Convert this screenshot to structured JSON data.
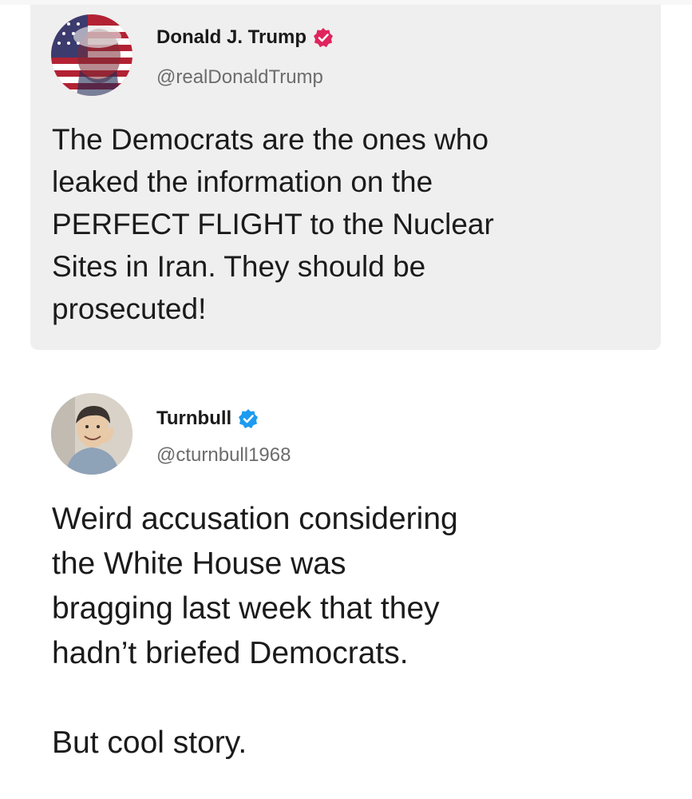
{
  "posts": [
    {
      "display_name": "Donald J. Trump",
      "handle": "@realDonaldTrump",
      "badge_color": "#e0245e",
      "body_lines": [
        "The Democrats are the ones who",
        "leaked the information on the",
        "PERFECT FLIGHT to the Nuclear",
        "Sites in Iran. They should be",
        "prosecuted!"
      ]
    },
    {
      "display_name": "Turnbull",
      "handle": "@cturnbull1968",
      "badge_color": "#1d9bf0",
      "body_lines": [
        "Weird accusation considering",
        "the White House was",
        "bragging last week that they",
        "hadn’t briefed Democrats."
      ],
      "closing_line": "But cool story."
    }
  ]
}
